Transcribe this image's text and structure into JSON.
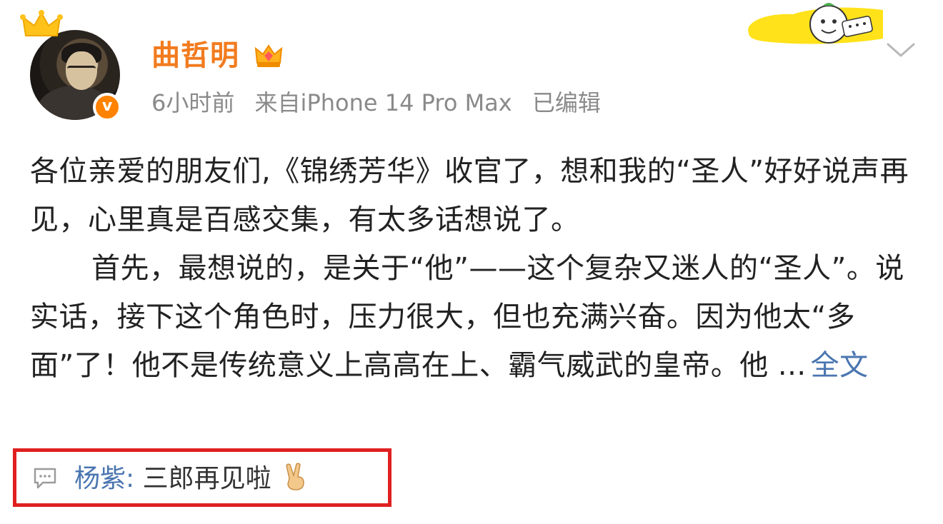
{
  "post": {
    "author": {
      "name": "曲哲明",
      "avatar_icon": "user-avatar",
      "crown_icon": "crown-icon",
      "member_icon": "vip-crown-icon",
      "verified_icon": "verified-v-icon",
      "verified_mark": "v",
      "name_color": "#f27b1e",
      "verified_color": "#ff8200"
    },
    "meta": {
      "time": "6小时前",
      "source": "来自iPhone 14 Pro Max",
      "edited": "已编辑"
    },
    "sticker_icon": "cartoon-sticker-icon",
    "more_icon": "chevron-down-icon",
    "content": {
      "paragraph1": "各位亲爱的朋友们,《锦绣芳华》收官了，想和我的“圣人”好好说声再见，心里真是百感交集，有太多话想说了。",
      "paragraph2": "首先，最想说的，是关于“他”——这个复杂又迷人的“圣人”。说实话，接下这个角色时，压力很大，但也充满兴奋。因为他太“多面”了！他不是传统意义上高高在上、霸气威武的皇帝。他 ...",
      "full_text_link": "全文",
      "link_color": "#4a76b0"
    },
    "top_comment": {
      "icon": "comment-icon",
      "commenter": "杨紫",
      "separator": ":",
      "text": " 三郎再见啦",
      "emoji": "victory-hand-icon",
      "highlight_color": "#e02020"
    }
  }
}
